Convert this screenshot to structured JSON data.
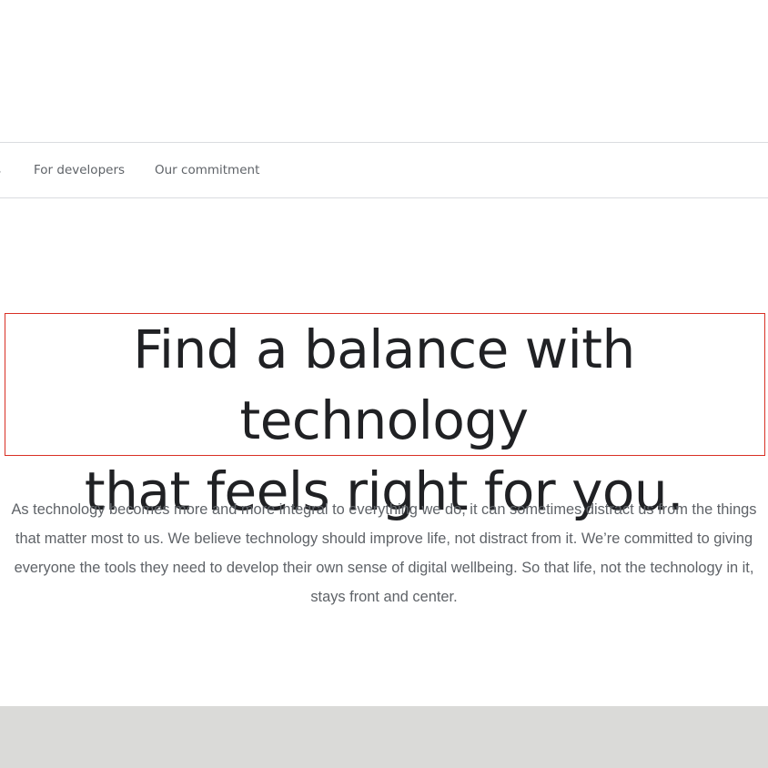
{
  "nav": {
    "partial_label": "s",
    "items": [
      {
        "label": "For developers"
      },
      {
        "label": "Our commitment"
      }
    ]
  },
  "hero": {
    "headline_line1": "Find a balance with technology",
    "headline_line2": "that feels right for you.",
    "body": "As technology becomes more and more integral to everything we do, it can sometimes distract us from the things that matter most to us. We believe technology should improve life, not distract from it. We’re committed to giving everyone the tools they need to develop their own sense of digital wellbeing. So that life, not the technology in it, stays front and center."
  },
  "colors": {
    "headline": "#202124",
    "body": "#5f6368",
    "nav_text": "#5f6368",
    "divider": "#dadce0",
    "focus_outline": "#d93025",
    "footer_band": "#dadad8"
  }
}
